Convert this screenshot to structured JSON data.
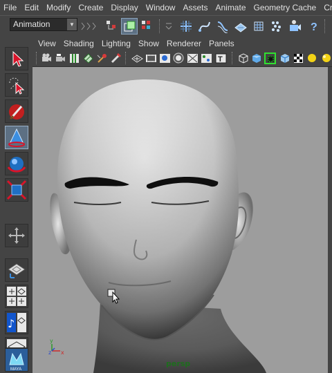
{
  "menu": [
    "File",
    "Edit",
    "Modify",
    "Create",
    "Display",
    "Window",
    "Assets",
    "Animate",
    "Geometry Cache",
    "Cre"
  ],
  "status_line": {
    "mode": "Animation"
  },
  "panel": {
    "menu": [
      "View",
      "Shading",
      "Lighting",
      "Show",
      "Renderer",
      "Panels"
    ],
    "camera": "persp"
  },
  "axis": {
    "y": "y",
    "z": "z",
    "x": "x"
  },
  "icons": {
    "toolbox": [
      "select-arrow-icon",
      "lasso-select-icon",
      "paint-select-icon",
      "move-tool-icon",
      "rotate-tool-icon",
      "scale-tool-icon",
      "manipulator-icon",
      "single-perspective-layout-icon",
      "four-view-layout-icon",
      "graph-editor-layout-icon",
      "outliner-layout-icon",
      "maya-logo-icon"
    ]
  },
  "colors": {
    "ui_bg": "#444444",
    "viewport_bg": "#9d9d9d",
    "active_tool": "#5d7083",
    "camera_label": "#1e6d1e"
  }
}
